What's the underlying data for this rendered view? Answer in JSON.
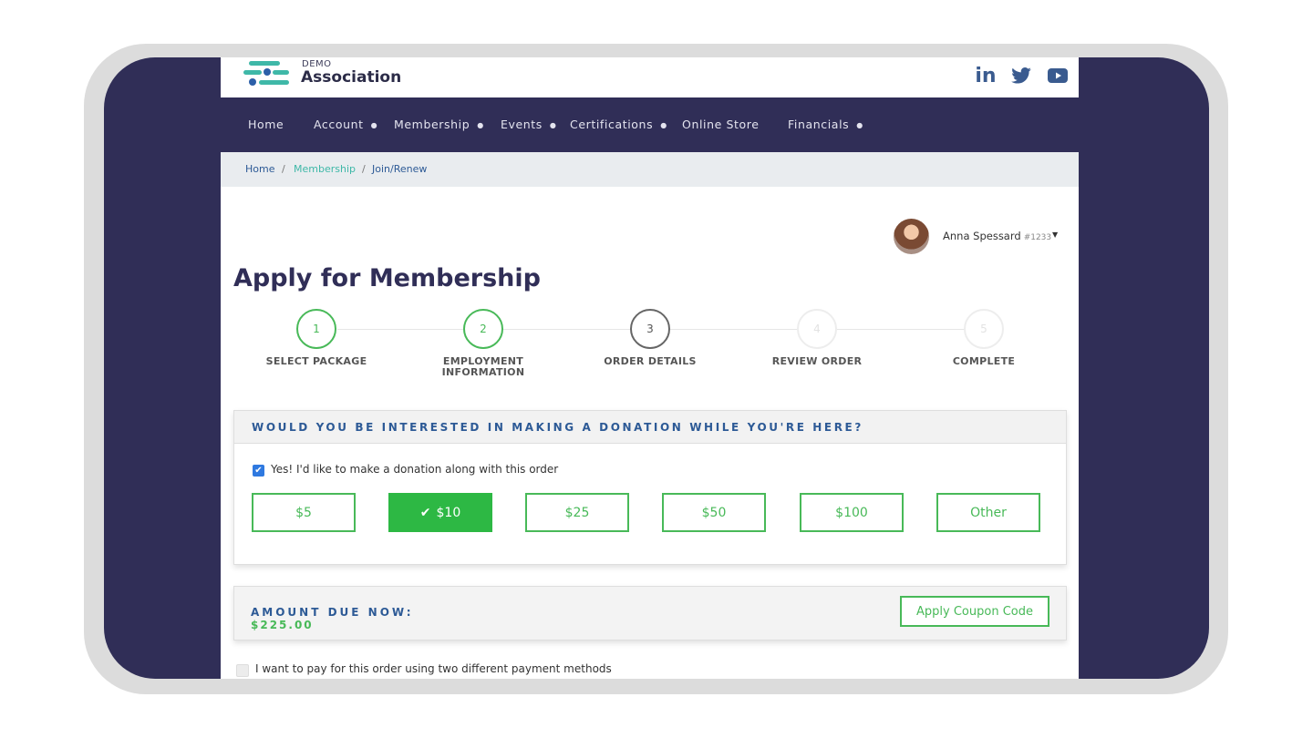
{
  "brand": {
    "small": "DEMO",
    "name": "Association",
    "colors": {
      "navy": "#302e57",
      "green": "#48b958",
      "blue": "#2d5a96",
      "teal": "#3fb8a8"
    }
  },
  "social": [
    "linkedin-icon",
    "twitter-icon",
    "youtube-icon"
  ],
  "social_text": {
    "linkedin": "in"
  },
  "nav": {
    "home": "Home",
    "account": "Account",
    "membership": "Membership",
    "events": "Events",
    "certifications": "Certifications",
    "online_store": "Online Store",
    "financials": "Financials"
  },
  "breadcrumb": {
    "home": "Home",
    "membership": "Membership",
    "current": "Join/Renew",
    "separator": "/"
  },
  "user": {
    "name": "Anna Spessard",
    "id": "#1233"
  },
  "page": {
    "title": "Apply for Membership"
  },
  "steps": [
    {
      "number": "1",
      "label": "SELECT PACKAGE",
      "state": "done"
    },
    {
      "number": "2",
      "label": "EMPLOYMENT INFORMATION",
      "state": "done"
    },
    {
      "number": "3",
      "label": "ORDER DETAILS",
      "state": "active"
    },
    {
      "number": "4",
      "label": "REVIEW ORDER",
      "state": "future"
    },
    {
      "number": "5",
      "label": "COMPLETE",
      "state": "future"
    }
  ],
  "donation": {
    "heading": "WOULD YOU BE INTERESTED IN MAKING A DONATION WHILE YOU'RE HERE?",
    "checkbox_label": "Yes! I'd like to make a donation along with this order",
    "checked": true,
    "amounts": [
      "$5",
      "$10",
      "$25",
      "$50",
      "$100",
      "Other"
    ],
    "selected": "$10"
  },
  "amount_due": {
    "label": "AMOUNT DUE NOW:",
    "value": "$225.00",
    "coupon_button": "Apply Coupon Code"
  },
  "split_payment": {
    "label": "I want to pay for this order using two different payment methods",
    "checked": false
  }
}
